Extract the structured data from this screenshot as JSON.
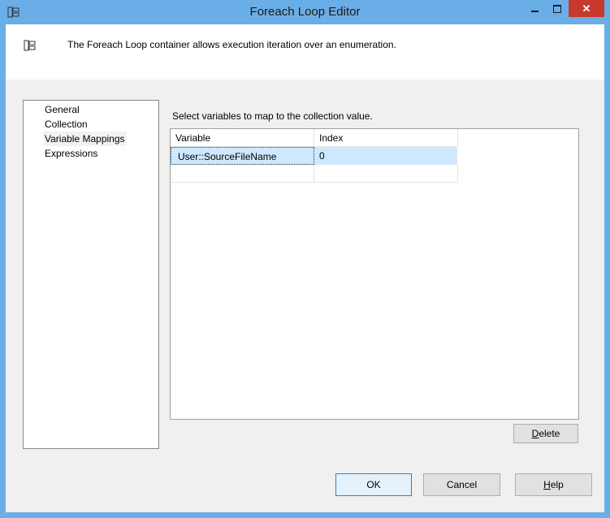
{
  "window": {
    "title": "Foreach Loop Editor",
    "close_glyph": "✕"
  },
  "header": {
    "description": "The Foreach Loop container allows execution iteration over an enumeration."
  },
  "nav": {
    "items": [
      {
        "label": "General"
      },
      {
        "label": "Collection"
      },
      {
        "label": "Variable Mappings",
        "selected": true
      },
      {
        "label": "Expressions"
      }
    ]
  },
  "mappings": {
    "instruction": "Select variables to map to the collection value.",
    "columns": [
      "Variable",
      "Index"
    ],
    "rows": [
      {
        "variable": "User::SourceFileName",
        "index": "0"
      }
    ]
  },
  "buttons": {
    "delete": "Delete",
    "delete_access": "D",
    "delete_rest": "elete",
    "ok": "OK",
    "cancel": "Cancel",
    "help_access": "H",
    "help_rest": "elp"
  },
  "colors": {
    "frame": "#6aaee7",
    "close": "#c7392c",
    "selected_row": "#cde8ff"
  }
}
